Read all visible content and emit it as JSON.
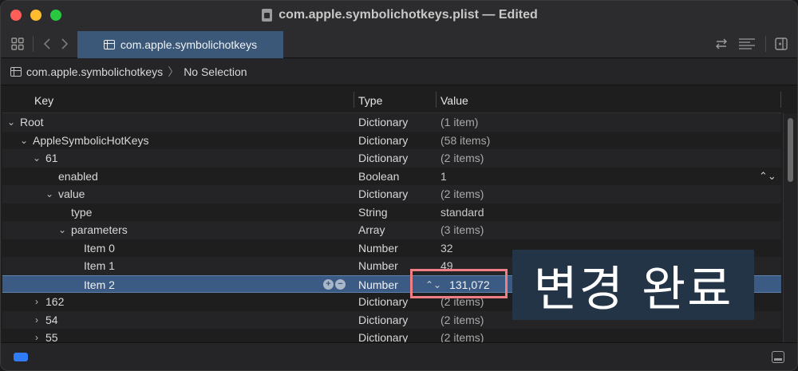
{
  "window": {
    "title": "com.apple.symbolichotkeys.plist — Edited"
  },
  "toolbar": {
    "tab_label": "com.apple.symbolichotkeys"
  },
  "breadcrumb": {
    "file": "com.apple.symbolichotkeys",
    "selection": "No Selection"
  },
  "columns": {
    "key": "Key",
    "type": "Type",
    "value": "Value"
  },
  "rows": [
    {
      "key": "Root",
      "type": "Dictionary",
      "value": "(1 item)"
    },
    {
      "key": "AppleSymbolicHotKeys",
      "type": "Dictionary",
      "value": "(58 items)"
    },
    {
      "key": "61",
      "type": "Dictionary",
      "value": "(2 items)"
    },
    {
      "key": "enabled",
      "type": "Boolean",
      "value": "1"
    },
    {
      "key": "value",
      "type": "Dictionary",
      "value": "(2 items)"
    },
    {
      "key": "type",
      "type": "String",
      "value": "standard"
    },
    {
      "key": "parameters",
      "type": "Array",
      "value": "(3 items)"
    },
    {
      "key": "Item 0",
      "type": "Number",
      "value": "32"
    },
    {
      "key": "Item 1",
      "type": "Number",
      "value": "49"
    },
    {
      "key": "Item 2",
      "type": "Number",
      "value": "131,072"
    },
    {
      "key": "162",
      "type": "Dictionary",
      "value": "(2 items)"
    },
    {
      "key": "54",
      "type": "Dictionary",
      "value": "(2 items)"
    },
    {
      "key": "55",
      "type": "Dictionary",
      "value": "(2 items)"
    }
  ],
  "overlay": {
    "label": "변경 완료"
  },
  "colors": {
    "selection": "#3b5b84",
    "highlight_border": "#f07f85",
    "tab": "#3b5878"
  },
  "icons": [
    "grid-icon",
    "back-chevron-icon",
    "forward-chevron-icon",
    "swap-arrows-icon",
    "lines-icon",
    "sidebar-icon",
    "stepper-icon",
    "add-icon",
    "remove-icon"
  ]
}
